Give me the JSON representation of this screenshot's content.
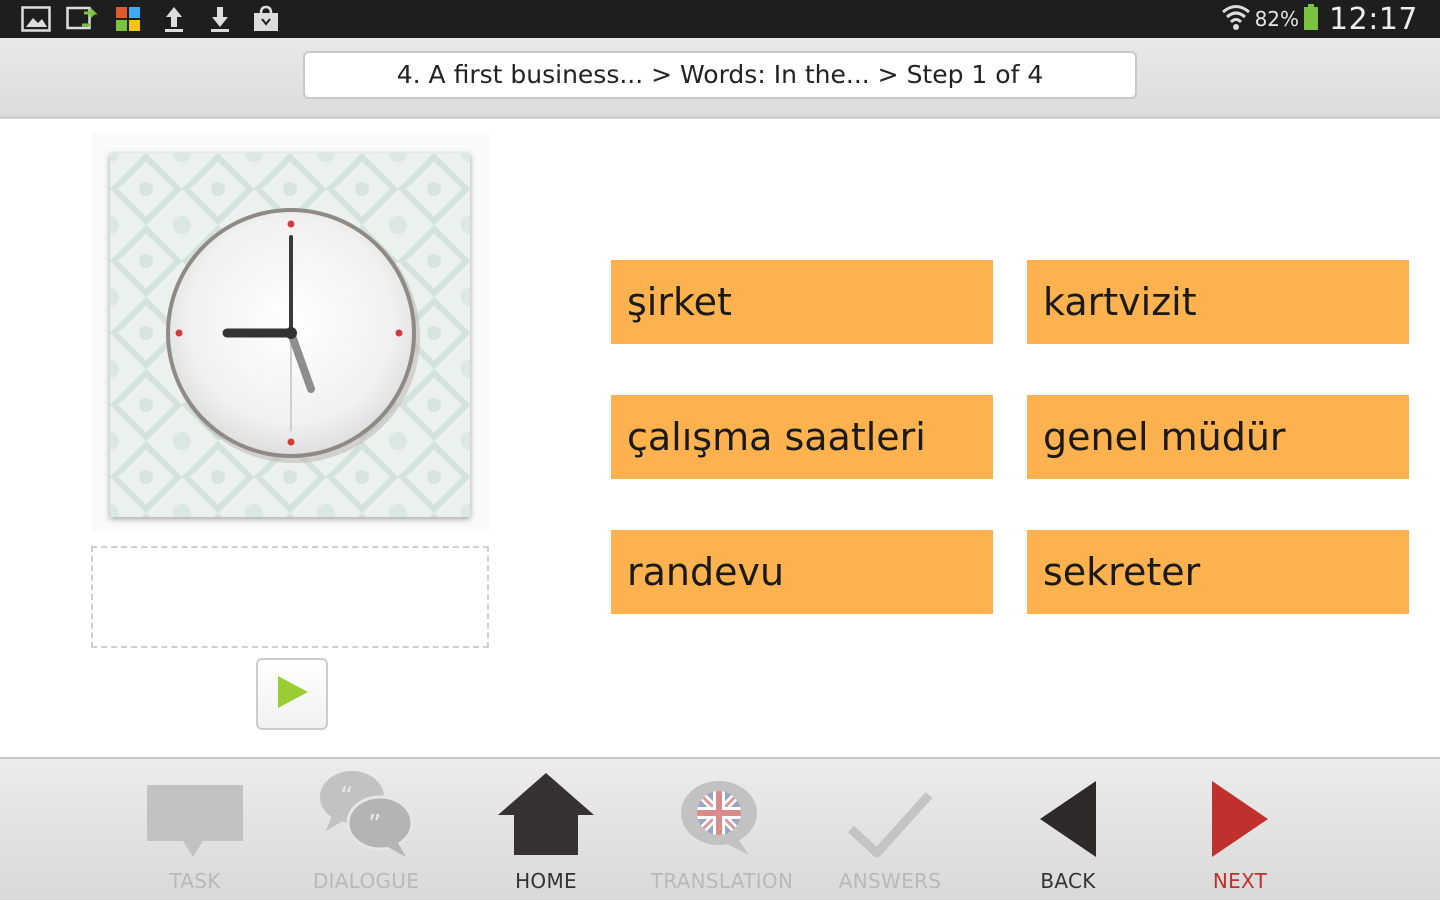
{
  "status_bar": {
    "battery": "82%",
    "time": "12:17",
    "icons": [
      "gallery-icon",
      "sync-icon",
      "app-icon",
      "upload-icon",
      "download-icon",
      "shopping-bag-icon"
    ]
  },
  "header": {
    "breadcrumb": "4. A first business... > Words: In the... > Step 1 of 4"
  },
  "exercise": {
    "picture": "clock-image",
    "words": [
      "şirket",
      "kartvizit",
      "çalışma saatleri",
      "genel müdür",
      "randevu",
      "sekreter"
    ]
  },
  "toolbar": {
    "task": "TASK",
    "dialogue": "DIALOGUE",
    "home": "HOME",
    "translation": "TRANSLATION",
    "answers": "ANSWERS",
    "back": "BACK",
    "next": "NEXT"
  },
  "colors": {
    "word_tile": "#fdb24f",
    "next_accent": "#c0302c",
    "play_icon": "#9acd32",
    "disabled_label": "#b9b9b9"
  }
}
